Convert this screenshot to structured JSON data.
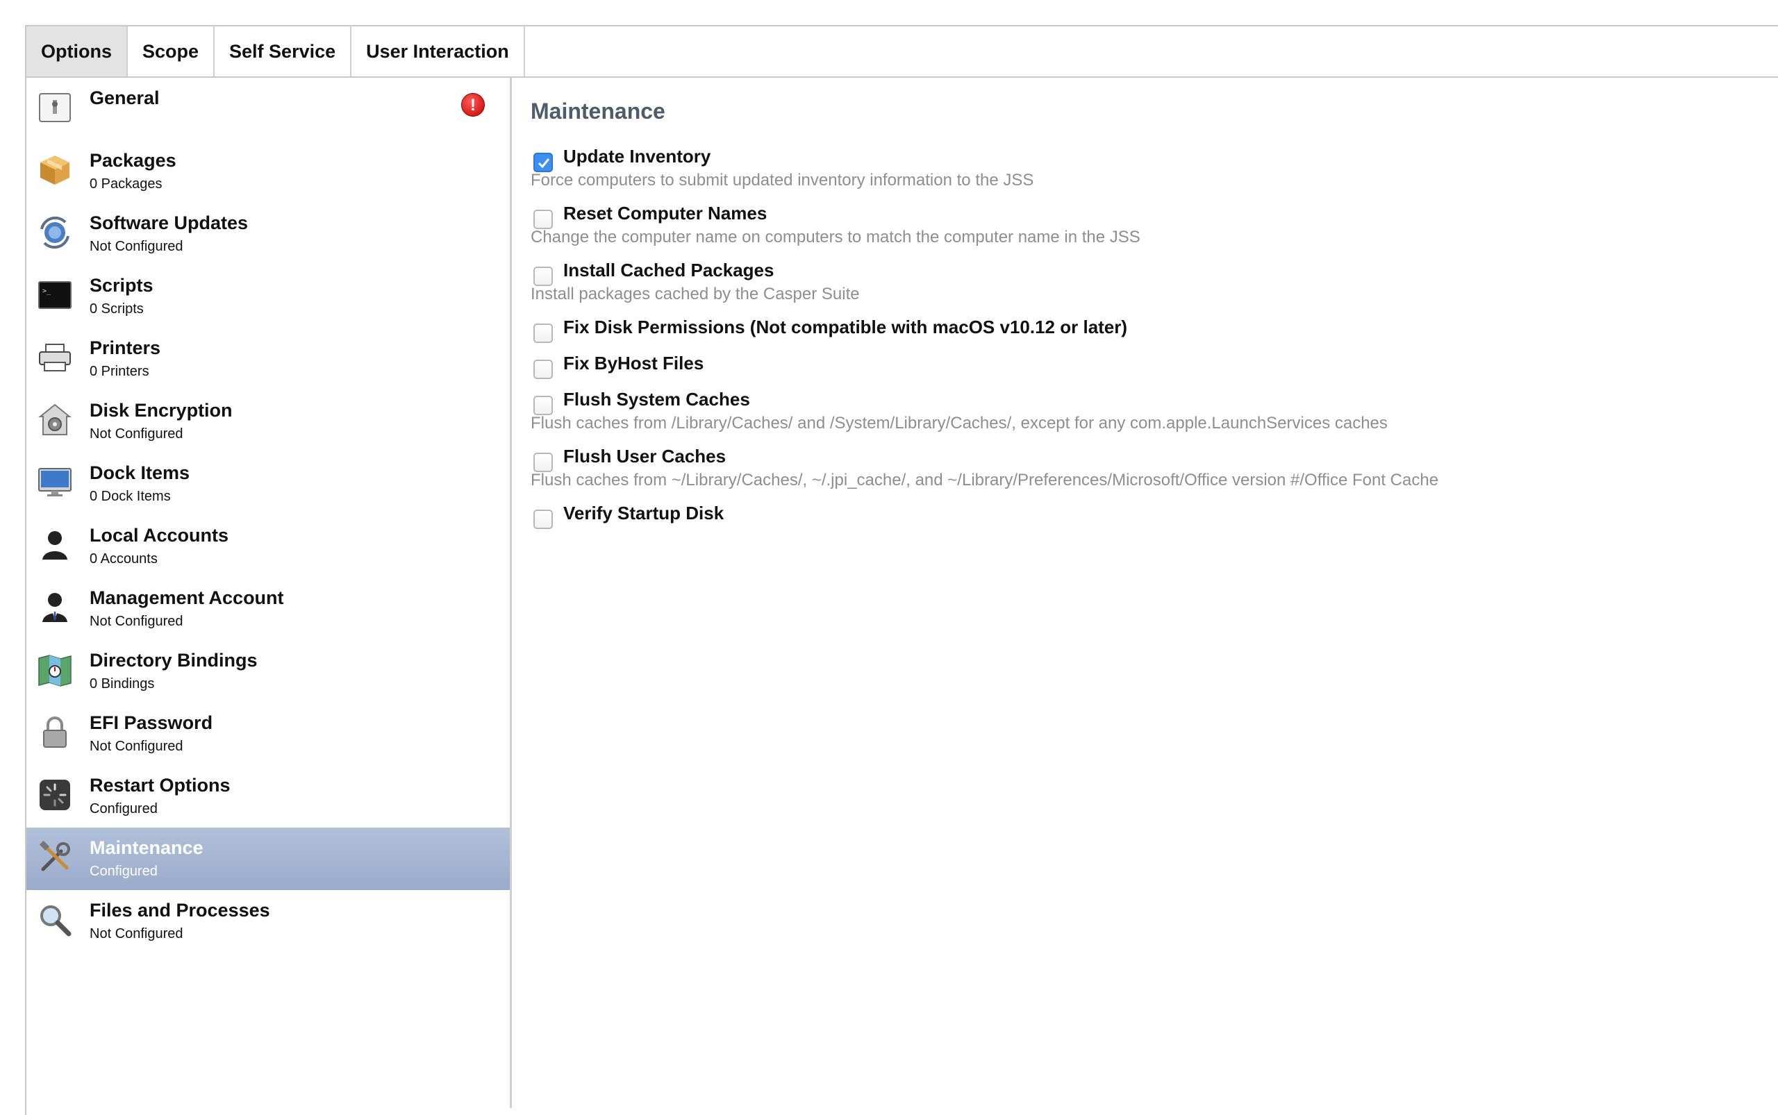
{
  "tabs": [
    {
      "label": "Options",
      "active": true
    },
    {
      "label": "Scope",
      "active": false
    },
    {
      "label": "Self Service",
      "active": false
    },
    {
      "label": "User Interaction",
      "active": false
    }
  ],
  "sidebar": {
    "items": [
      {
        "title": "General",
        "subtitle": "",
        "icon": "general-icon",
        "error_badge": "!"
      },
      {
        "title": "Packages",
        "subtitle": "0 Packages",
        "icon": "package-icon"
      },
      {
        "title": "Software Updates",
        "subtitle": "Not Configured",
        "icon": "software-update-icon"
      },
      {
        "title": "Scripts",
        "subtitle": "0 Scripts",
        "icon": "terminal-icon"
      },
      {
        "title": "Printers",
        "subtitle": "0 Printers",
        "icon": "printer-icon"
      },
      {
        "title": "Disk Encryption",
        "subtitle": "Not Configured",
        "icon": "disk-encryption-icon"
      },
      {
        "title": "Dock Items",
        "subtitle": "0 Dock Items",
        "icon": "monitor-icon"
      },
      {
        "title": "Local Accounts",
        "subtitle": "0 Accounts",
        "icon": "user-icon"
      },
      {
        "title": "Management Account",
        "subtitle": "Not Configured",
        "icon": "manager-user-icon"
      },
      {
        "title": "Directory Bindings",
        "subtitle": "0 Bindings",
        "icon": "map-icon"
      },
      {
        "title": "EFI Password",
        "subtitle": "Not Configured",
        "icon": "lock-icon"
      },
      {
        "title": "Restart Options",
        "subtitle": "Configured",
        "icon": "restart-icon"
      },
      {
        "title": "Maintenance",
        "subtitle": "Configured",
        "icon": "tools-icon",
        "selected": true
      },
      {
        "title": "Files and Processes",
        "subtitle": "Not Configured",
        "icon": "magnifier-icon"
      }
    ]
  },
  "main": {
    "title": "Maintenance",
    "options": [
      {
        "label": "Update Inventory",
        "checked": true,
        "description": "Force computers to submit updated inventory information to the JSS"
      },
      {
        "label": "Reset Computer Names",
        "checked": false,
        "description": "Change the computer name on computers to match the computer name in the JSS"
      },
      {
        "label": "Install Cached Packages",
        "checked": false,
        "description": "Install packages cached by the Casper Suite"
      },
      {
        "label": "Fix Disk Permissions (Not compatible with macOS v10.12 or later)",
        "checked": false,
        "description": ""
      },
      {
        "label": "Fix ByHost Files",
        "checked": false,
        "description": ""
      },
      {
        "label": "Flush System Caches",
        "checked": false,
        "description": "Flush caches from /Library/Caches/ and /System/Library/Caches/, except for any com.apple.LaunchServices caches"
      },
      {
        "label": "Flush User Caches",
        "checked": false,
        "description": "Flush caches from ~/Library/Caches/, ~/.jpi_cache/, and ~/Library/Preferences/Microsoft/Office version #/Office Font Cache"
      },
      {
        "label": "Verify Startup Disk",
        "checked": false,
        "description": ""
      }
    ]
  },
  "colors": {
    "selected_row": "#a6b6d3",
    "checkbox_checked": "#3b8ff3",
    "section_title": "#4f5a6a",
    "description_text": "#8e8e8e",
    "error_badge": "#d40000"
  }
}
